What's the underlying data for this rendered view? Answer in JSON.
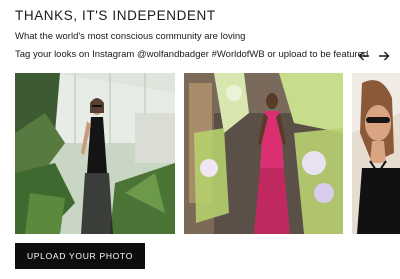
{
  "header": {
    "title": "THANKS, IT'S INDEPENDENT",
    "subtitle": "What the world's most conscious community are loving",
    "tagline": "Tag your looks on Instagram @wolfandbadger #WorldofWB or upload to be featured"
  },
  "nav": {
    "prev_icon": "arrow-left-icon",
    "next_icon": "arrow-right-icon"
  },
  "gallery": {
    "items": [
      {
        "subject": "woman in black lace dress in greenhouse"
      },
      {
        "subject": "woman in pink sequin gown before floral wall"
      },
      {
        "subject": "woman with sunglasses in black halter top"
      }
    ]
  },
  "upload_button": {
    "label": "UPLOAD YOUR PHOTO"
  },
  "colors": {
    "button_bg": "#0d0d0d",
    "text": "#1a1a1a",
    "background": "#ffffff"
  }
}
